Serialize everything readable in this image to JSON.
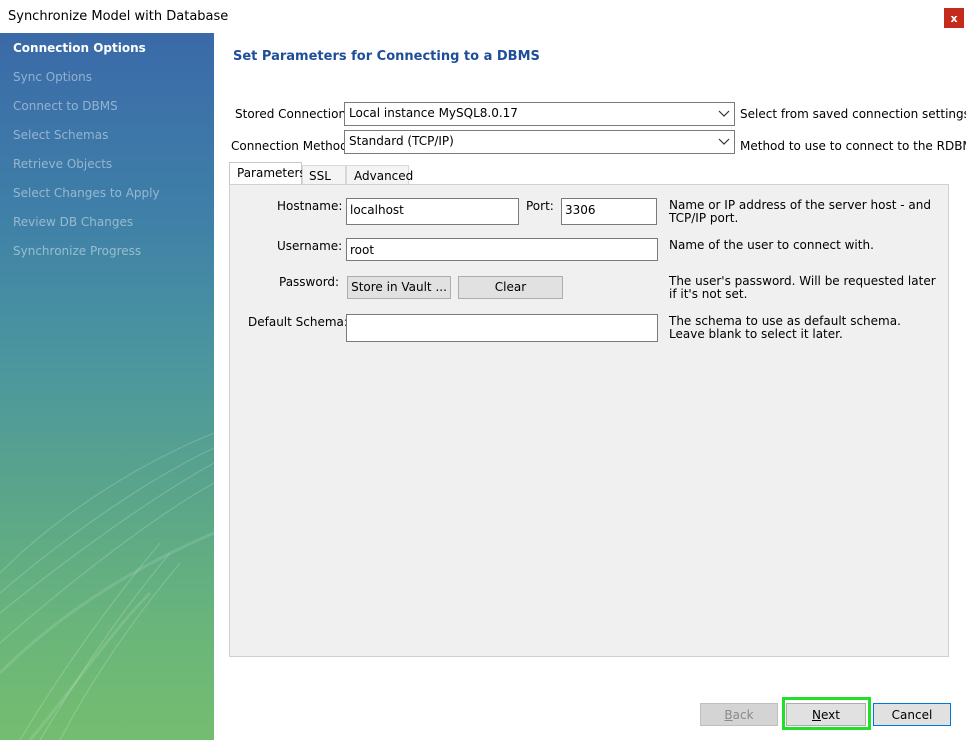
{
  "window": {
    "title": "Synchronize Model with Database",
    "close_label": "x"
  },
  "sidebar": {
    "items": [
      {
        "label": "Connection Options",
        "active": true
      },
      {
        "label": "Sync Options",
        "active": false
      },
      {
        "label": "Connect to DBMS",
        "active": false
      },
      {
        "label": "Select Schemas",
        "active": false
      },
      {
        "label": "Retrieve Objects",
        "active": false
      },
      {
        "label": "Select Changes to Apply",
        "active": false
      },
      {
        "label": "Review DB Changes",
        "active": false
      },
      {
        "label": "Synchronize Progress",
        "active": false
      }
    ]
  },
  "main": {
    "heading": "Set Parameters for Connecting to a DBMS",
    "stored_connection": {
      "label": "Stored Connection:",
      "value": "Local instance MySQL8.0.17",
      "hint": "Select from saved connection settings"
    },
    "connection_method": {
      "label": "Connection Method:",
      "value": "Standard (TCP/IP)",
      "hint": "Method to use to connect to the RDBMS"
    },
    "tabs": [
      {
        "label": "Parameters",
        "active": true
      },
      {
        "label": "SSL",
        "active": false
      },
      {
        "label": "Advanced",
        "active": false
      }
    ],
    "params": {
      "hostname_label": "Hostname:",
      "hostname_value": "localhost",
      "port_label": "Port:",
      "port_value": "3306",
      "hostname_desc": "Name or IP address of the server host - and TCP/IP port.",
      "username_label": "Username:",
      "username_value": "root",
      "username_desc": "Name of the user to connect with.",
      "password_label": "Password:",
      "store_vault_label": "Store in Vault ...",
      "clear_label": "Clear",
      "password_desc": "The user's password. Will be requested later if it's not set.",
      "schema_label": "Default Schema:",
      "schema_value": "",
      "schema_desc": "The schema to use as default schema. Leave blank to select it later."
    }
  },
  "footer": {
    "back_mnemonic": "B",
    "back_rest": "ack",
    "next_mnemonic": "N",
    "next_rest": "ext",
    "cancel_label": "Cancel"
  },
  "colors": {
    "accent": "#1f4e99",
    "highlight": "#22e02a",
    "close": "#c42b1c"
  }
}
